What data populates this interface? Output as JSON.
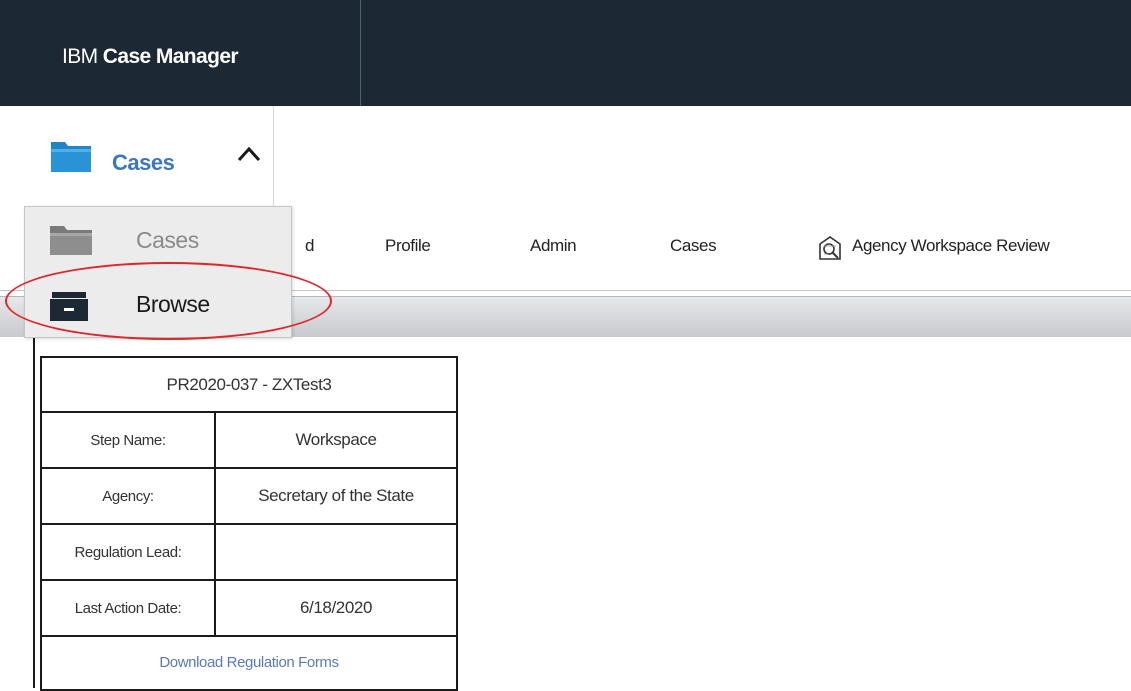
{
  "header": {
    "brand_prefix": "IBM",
    "brand_name": "Case Manager",
    "background_color": "#1c2834"
  },
  "cases_menu": {
    "label": "Cases",
    "accent_color": "#3b76c5",
    "icon": "folder-icon",
    "chevron": "chevron-up-icon"
  },
  "dropdown": {
    "items": [
      {
        "label": "Cases",
        "icon": "folder-icon"
      },
      {
        "label": "Browse",
        "icon": "browse-icon"
      }
    ],
    "highlight_color": "#e0262a"
  },
  "tabs": [
    {
      "label": "d"
    },
    {
      "label": "Profile"
    },
    {
      "label": "Admin"
    },
    {
      "label": "Cases"
    },
    {
      "label": "Agency Workspace Review",
      "icon": "workspace-review-icon"
    }
  ],
  "case_card": {
    "title": "PR2020-037 - ZXTest3",
    "rows": [
      {
        "label": "Step Name:",
        "value": "Workspace"
      },
      {
        "label": "Agency:",
        "value": "Secretary of the State"
      },
      {
        "label": "Regulation Lead:",
        "value": ""
      },
      {
        "label": "Last Action Date:",
        "value": "6/18/2020"
      }
    ],
    "link": "Download Regulation Forms",
    "link_color": "#5b7ab8"
  }
}
